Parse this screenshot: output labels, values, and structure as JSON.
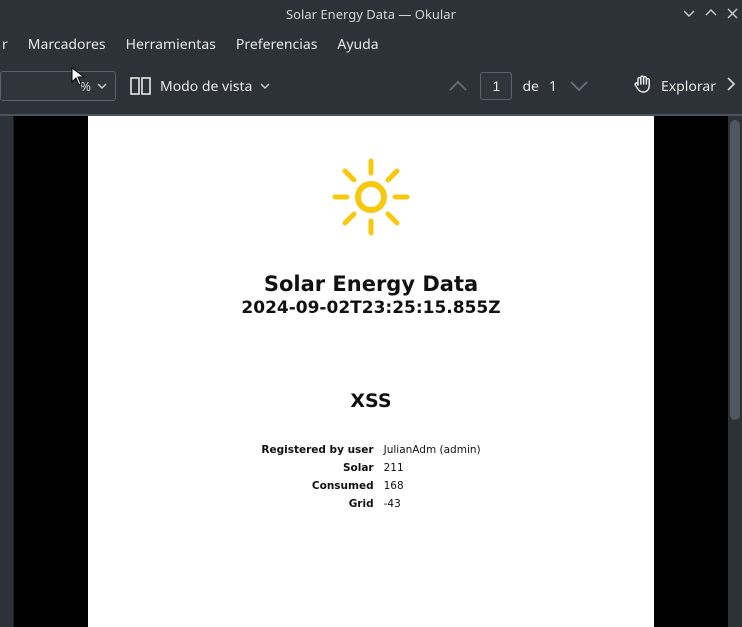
{
  "window": {
    "title": "Solar Energy Data — Okular"
  },
  "menu": {
    "item_cut": "r",
    "bookmarks": "Marcadores",
    "tools": "Herramientas",
    "prefs": "Preferencias",
    "help": "Ayuda"
  },
  "toolbar": {
    "zoom_text": "%",
    "viewmode_label": "Modo de vista",
    "page_current": "1",
    "page_of_label": "de",
    "page_total": "1",
    "explore_label": "Explorar"
  },
  "document": {
    "heading": "Solar Energy Data",
    "timestamp": "2024-09-02T23:25:15.855Z",
    "section": "XSS",
    "fields": {
      "registered_by_label": "Registered by user",
      "registered_by_value": "JulianAdm (admin)",
      "solar_label": "Solar",
      "solar_value": "211",
      "consumed_label": "Consumed",
      "consumed_value": "168",
      "grid_label": "Grid",
      "grid_value": "-43"
    }
  }
}
